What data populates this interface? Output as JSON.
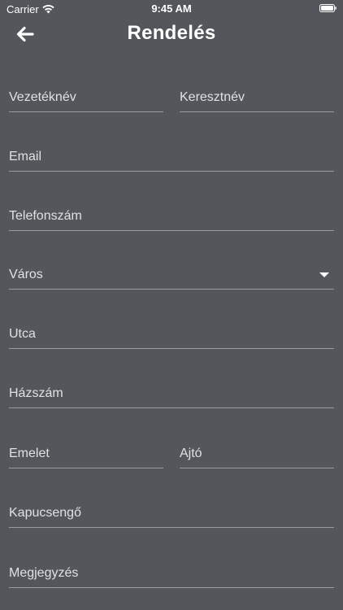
{
  "status_bar": {
    "carrier": "Carrier",
    "time": "9:45 AM",
    "icons": [
      "wifi-icon",
      "battery-icon"
    ]
  },
  "header": {
    "title": "Rendelés",
    "back_icon": "arrow-left-icon"
  },
  "form": {
    "last_name": "Vezetéknév",
    "first_name": "Keresztnév",
    "email": "Email",
    "phone": "Telefonszám",
    "city": "Város",
    "street": "Utca",
    "house_number": "Házszám",
    "floor": "Emelet",
    "door": "Ajtó",
    "doorbell": "Kapucsengő",
    "note": "Megjegyzés"
  },
  "colors": {
    "background": "#53565a",
    "text": "#ffffff",
    "underline": "#9a9c9f"
  }
}
